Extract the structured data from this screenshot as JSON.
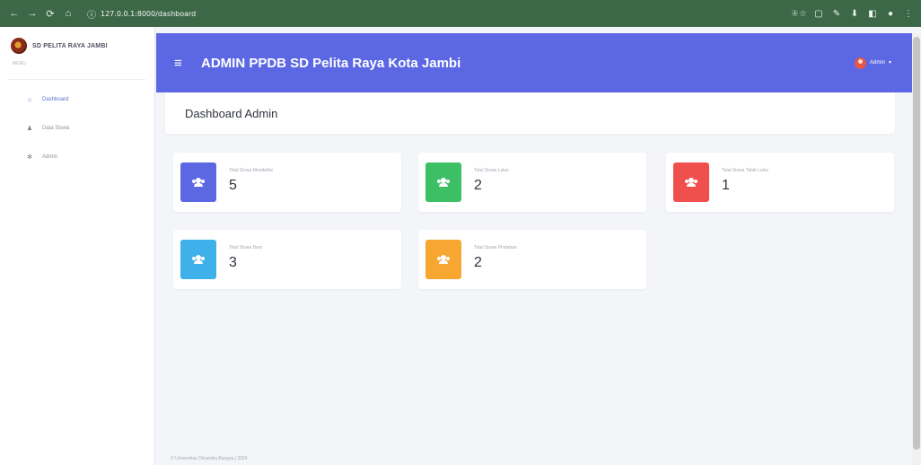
{
  "browser": {
    "url": "127.0.0.1:8000/dashboard",
    "right_text": "Ⓐ ☆"
  },
  "sidebar": {
    "brand": "SD PELITA RAYA JAMBI",
    "heading": "MENU",
    "items": [
      {
        "label": "Dashboard",
        "icon": "home-icon",
        "active": true
      },
      {
        "label": "Data Siswa",
        "icon": "user-icon",
        "active": false
      },
      {
        "label": "Admin",
        "icon": "gear-icon",
        "active": false
      }
    ]
  },
  "topbar": {
    "title": "ADMIN PPDB SD Pelita Raya Kota Jambi",
    "user": "Admin"
  },
  "page": {
    "title": "Dashboard Admin"
  },
  "cards": [
    {
      "label": "Total Siswa Mendaftar",
      "value": "5",
      "color": "#5b67e3"
    },
    {
      "label": "Total Siswa Lulus",
      "value": "2",
      "color": "#3cbf65"
    },
    {
      "label": "Total Siswa Tidak Lulus",
      "value": "1",
      "color": "#f0504d"
    },
    {
      "label": "Total Siswa Baru",
      "value": "3",
      "color": "#3fb0ea"
    },
    {
      "label": "Total Siswa Pindahan",
      "value": "2",
      "color": "#f7a631"
    }
  ],
  "footer": {
    "text": "© Universitas Dinamika Bangsa | 2024"
  }
}
